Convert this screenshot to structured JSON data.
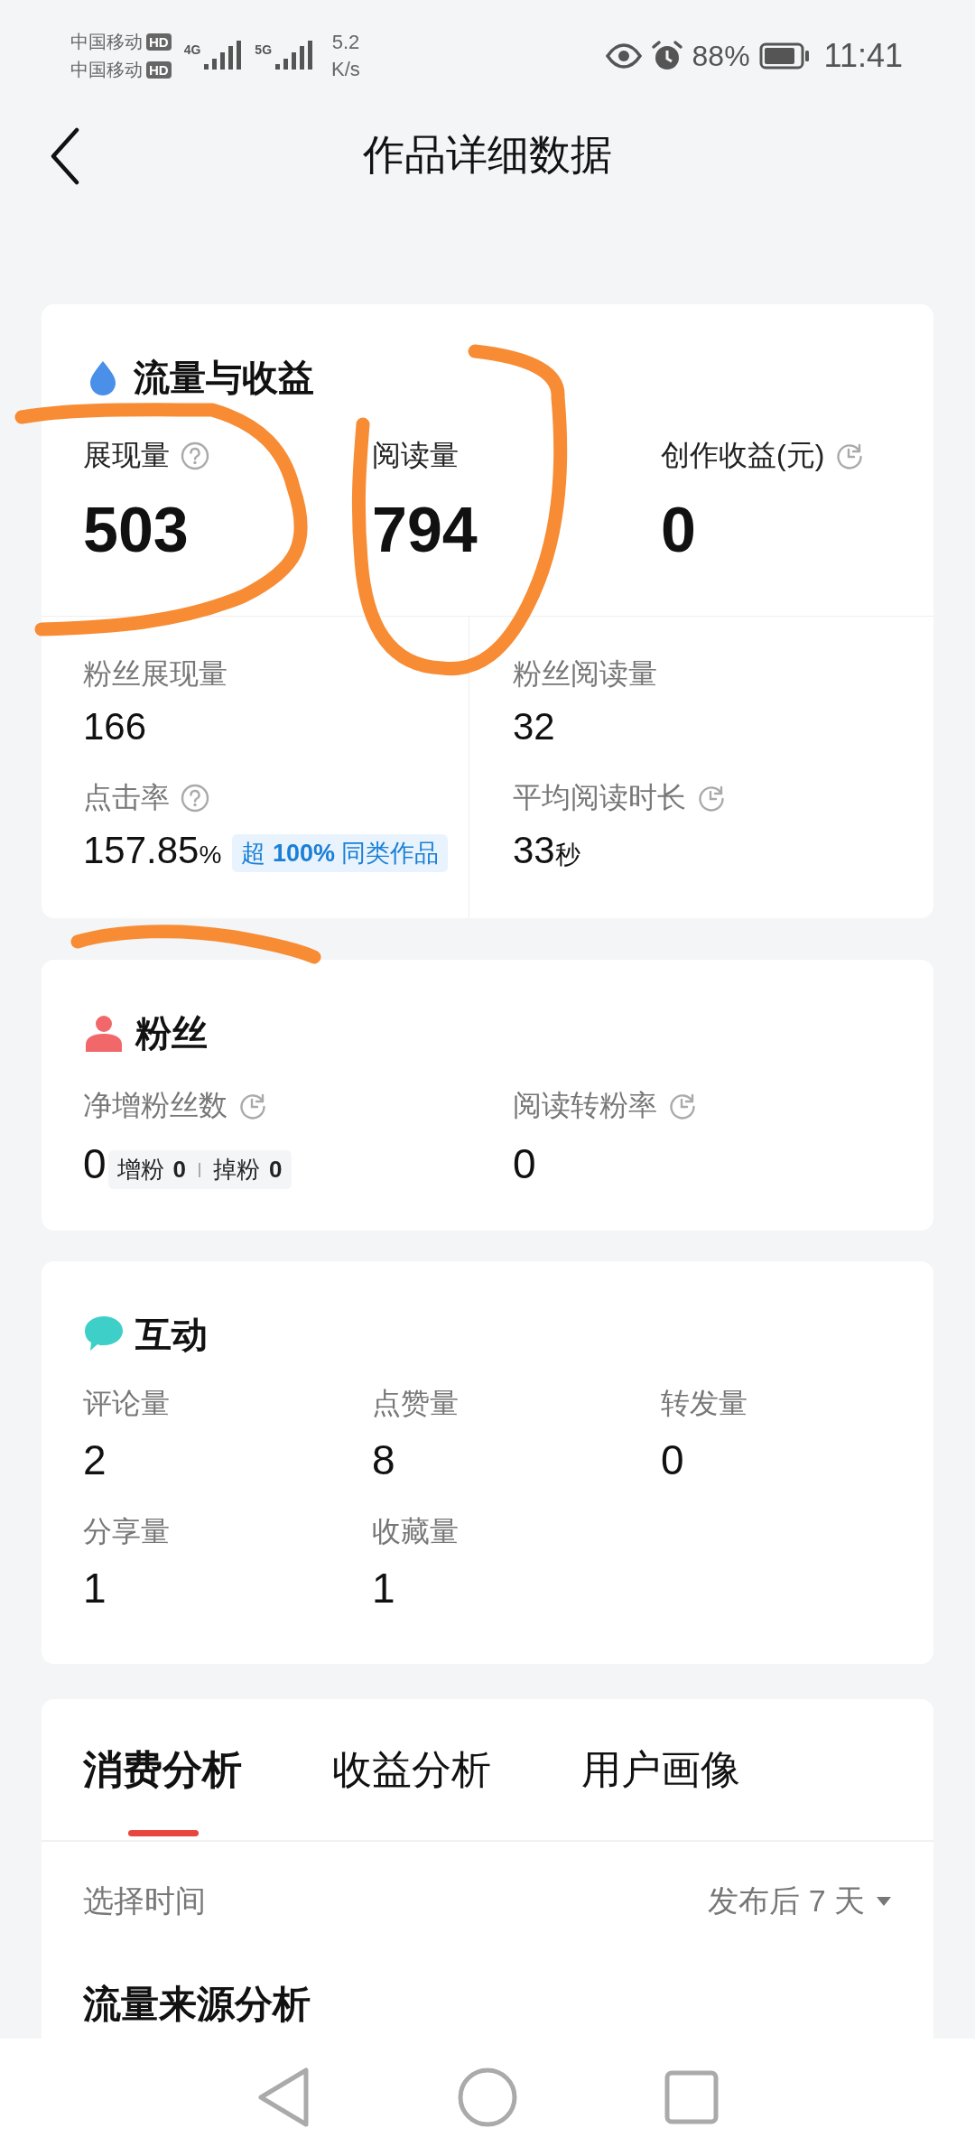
{
  "status_bar": {
    "carriers": [
      {
        "name": "中国移动",
        "badge": "HD"
      },
      {
        "name": "中国移动",
        "badge": "HD"
      }
    ],
    "networks": [
      "4G",
      "5G"
    ],
    "speed": [
      "5.2",
      "K/s"
    ],
    "battery_text": "88%",
    "time": "11:41"
  },
  "header": {
    "title": "作品详细数据"
  },
  "traffic": {
    "title": "流量与收益",
    "top_metrics": [
      {
        "kind": "help",
        "label": "展现量",
        "value": "503"
      },
      {
        "kind": "plain",
        "label": "阅读量",
        "value": "794"
      },
      {
        "kind": "timed",
        "label": "创作收益(元)",
        "value": "0"
      }
    ],
    "sub_metrics": [
      {
        "kind": "plain",
        "label": "粉丝展现量",
        "value": "166"
      },
      {
        "kind": "plain",
        "label": "粉丝阅读量",
        "value": "32"
      },
      {
        "kind": "help",
        "label": "点击率",
        "value": "157.85",
        "unit": "%",
        "badge": "超 **100%** 同类作品"
      },
      {
        "kind": "timed",
        "label": "平均阅读时长",
        "value": "33",
        "unit": "秒"
      }
    ]
  },
  "fans": {
    "title": "粉丝",
    "metrics": [
      {
        "kind": "timed",
        "label": "净增粉丝数",
        "value": "0",
        "breakdown": [
          {
            "label": "增粉",
            "value": "0"
          },
          {
            "label": "掉粉",
            "value": "0"
          }
        ]
      },
      {
        "kind": "timed",
        "label": "阅读转粉率",
        "value": "0"
      }
    ]
  },
  "interaction": {
    "title": "互动",
    "metrics": [
      {
        "label": "评论量",
        "value": "2"
      },
      {
        "label": "点赞量",
        "value": "8"
      },
      {
        "label": "转发量",
        "value": "0"
      },
      {
        "label": "分享量",
        "value": "1"
      },
      {
        "label": "收藏量",
        "value": "1"
      }
    ]
  },
  "analysis": {
    "tabs": [
      {
        "label": "消费分析",
        "selected": true
      },
      {
        "label": "收益分析",
        "selected": false
      },
      {
        "label": "用户画像",
        "selected": false
      }
    ],
    "time_filter": {
      "label": "选择时间",
      "value": "发布后 7 天"
    },
    "section_title": "流量来源分析"
  }
}
